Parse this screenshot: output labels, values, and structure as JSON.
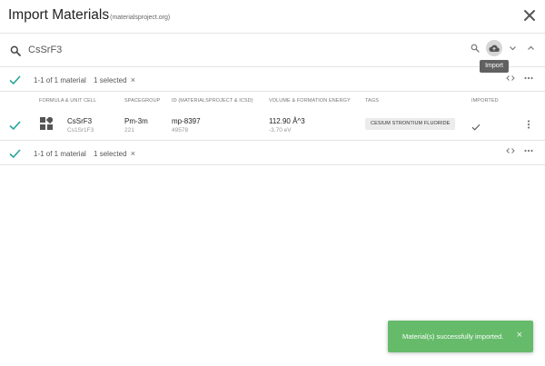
{
  "dialog": {
    "title": "Import Materials",
    "subtitle": "(materialsproject.org)"
  },
  "search": {
    "query": "CsSrF3",
    "tooltip": "Import"
  },
  "summary": {
    "range": "1-1 of 1 material",
    "selected": "1 selected",
    "clear_glyph": "×"
  },
  "table": {
    "columns": {
      "formula": "FORMULA & UNIT CELL",
      "spacegroup": "SPACEGROUP",
      "id": "ID (MATERIALSPROJECT & ICSD)",
      "volume": "VOLUME & FORMATION ENERGY",
      "tags": "TAGS",
      "imported": "IMPORTED"
    },
    "rows": [
      {
        "formula": "CsSrF3",
        "unit_cell": "Cs1Sr1F3",
        "spacegroup": "Pm-3m",
        "spacegroup_number": "221",
        "mp_id": "mp-8397",
        "icsd_id": "49578",
        "volume": "112.90 Å^3",
        "formation_energy": "-3.70 eV",
        "tag": "CESIUM STRONTIUM FLUORIDE",
        "imported": true
      }
    ]
  },
  "toast": {
    "message": "Material(s) successfully imported.",
    "close_glyph": "×"
  },
  "colors": {
    "accent": "#26a69a",
    "toast": "#66bb6a"
  },
  "icons": [
    "close-icon",
    "search-icon",
    "cloud-upload-icon",
    "chevron-down-icon",
    "chevron-up-icon",
    "check-icon",
    "code-icon",
    "more-horizontal-icon",
    "more-vertical-icon",
    "cube-icon"
  ]
}
